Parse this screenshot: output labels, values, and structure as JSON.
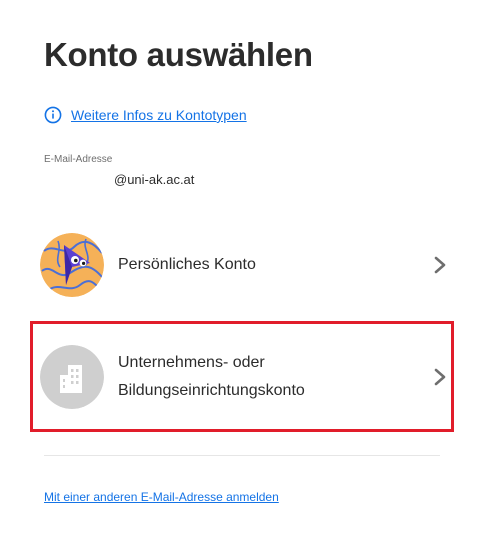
{
  "page": {
    "title": "Konto auswählen",
    "info_link": "Weitere Infos zu Kontotypen",
    "email_label": "E-Mail-Adresse",
    "email_value": "@uni-ak.ac.at",
    "other_email_link": "Mit einer anderen E-Mail-Adresse anmelden"
  },
  "accounts": [
    {
      "label": "Persönliches Konto",
      "icon": "personal-avatar-icon"
    },
    {
      "label_line1": "Unternehmens- oder",
      "label_line2": "Bildungseinrichtungskonto",
      "icon": "building-icon"
    }
  ],
  "colors": {
    "link": "#1473e6",
    "highlight_border": "#e11d2a",
    "avatar_bg": "#f5b158",
    "building_bg": "#cfcfcf"
  }
}
